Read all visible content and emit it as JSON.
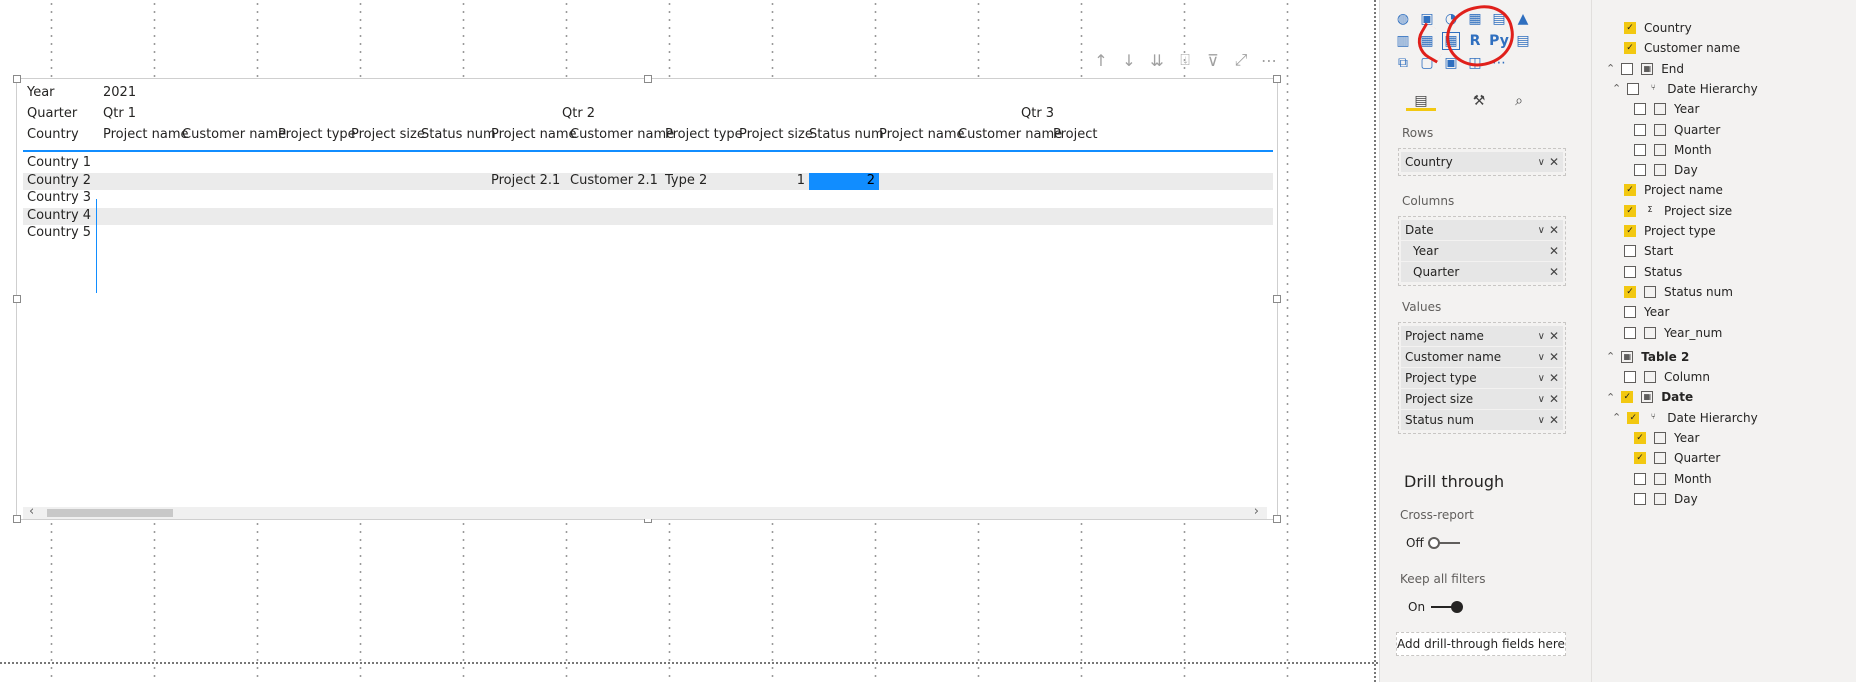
{
  "matrix": {
    "header_rows": [
      {
        "label": "Year",
        "groups": [
          {
            "text": "2021"
          }
        ]
      },
      {
        "label": "Quarter",
        "groups": [
          {
            "text": "Qtr 1"
          },
          {
            "text": "Qtr 2"
          },
          {
            "text": "Qtr 3"
          }
        ]
      },
      {
        "label": "Country",
        "columns": [
          "Project name",
          "Customer name",
          "Project type",
          "Project size",
          "Status num",
          "Project name",
          "Customer name",
          "Project type",
          "Project size",
          "Status num",
          "Project name",
          "Customer name",
          "Project"
        ]
      }
    ],
    "rows": [
      {
        "label": "Country 1",
        "cells": []
      },
      {
        "label": "Country 2",
        "cells": [
          "Project 2.1",
          "Customer 2.1",
          "Type 2",
          "1",
          "2"
        ]
      },
      {
        "label": "Country 3",
        "cells": []
      },
      {
        "label": "Country 4",
        "cells": []
      },
      {
        "label": "Country 5",
        "cells": []
      }
    ],
    "highlight_color": "#118dff"
  },
  "viz_pane": {
    "sections": {
      "rows": "Rows",
      "columns": "Columns",
      "values": "Values"
    },
    "rows_fields": [
      "Country"
    ],
    "columns_fields": {
      "parent": "Date",
      "children": [
        "Year",
        "Quarter"
      ]
    },
    "values_fields": [
      "Project name",
      "Customer name",
      "Project type",
      "Project size",
      "Status num"
    ],
    "drill_through": {
      "title": "Drill through",
      "cross_report": "Cross-report",
      "cross_report_state": "Off",
      "keep_filters": "Keep all filters",
      "keep_filters_state": "On",
      "add_button": "Add drill-through fields here"
    },
    "icons": [
      "r-script-icon",
      "python-icon"
    ],
    "r_label": "R",
    "py_label": "Py"
  },
  "fields": [
    {
      "label": "Country",
      "checked": true,
      "indent": 1
    },
    {
      "label": "Customer name",
      "checked": true,
      "indent": 1
    },
    {
      "label": "End",
      "checked": false,
      "indent": 0,
      "expand": "^"
    },
    {
      "label": "Date Hierarchy",
      "checked": false,
      "indent": 1,
      "expand": "^"
    },
    {
      "label": "Year",
      "checked": false,
      "indent": 2
    },
    {
      "label": "Quarter",
      "checked": false,
      "indent": 2
    },
    {
      "label": "Month",
      "checked": false,
      "indent": 2
    },
    {
      "label": "Day",
      "checked": false,
      "indent": 2
    },
    {
      "label": "Project name",
      "checked": true,
      "indent": 1
    },
    {
      "label": "Project size",
      "checked": true,
      "indent": 1
    },
    {
      "label": "Project type",
      "checked": true,
      "indent": 1
    },
    {
      "label": "Start",
      "checked": false,
      "indent": 1
    },
    {
      "label": "Status",
      "checked": false,
      "indent": 1
    },
    {
      "label": "Status num",
      "checked": true,
      "indent": 1
    },
    {
      "label": "Year",
      "checked": false,
      "indent": 1
    },
    {
      "label": "Year_num",
      "checked": false,
      "indent": 1
    },
    {
      "label": "Table 2",
      "checked": null,
      "indent": -1,
      "expand": "^"
    },
    {
      "label": "Column",
      "checked": false,
      "indent": 1
    },
    {
      "label": "Date",
      "checked": true,
      "indent": 0,
      "expand": "^"
    },
    {
      "label": "Date Hierarchy",
      "checked": true,
      "indent": 1,
      "expand": "^"
    },
    {
      "label": "Year",
      "checked": true,
      "indent": 2
    },
    {
      "label": "Quarter",
      "checked": true,
      "indent": 2
    },
    {
      "label": "Month",
      "checked": false,
      "indent": 2
    },
    {
      "label": "Day",
      "checked": false,
      "indent": 2
    }
  ],
  "colors": {
    "accent": "#118dff",
    "checkbox": "#f2c811",
    "annotation": "#e0201b"
  }
}
